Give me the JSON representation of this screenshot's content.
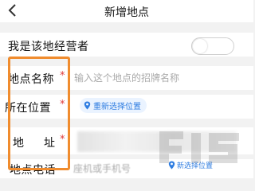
{
  "nav": {
    "title": "新增地点"
  },
  "owner_row": {
    "label": "我是该地经营者",
    "toggle_on": false
  },
  "name_row": {
    "label": "地点名称",
    "required_mark": "*",
    "placeholder": "输入这个地点的招牌名称"
  },
  "position_row": {
    "label": "所在位置",
    "required_mark": "*",
    "button_label": "重新选择位置"
  },
  "address_row": {
    "label_first": "地",
    "label_second": "址",
    "required_mark": "*"
  },
  "phone_row": {
    "label": "地点电话",
    "placeholder": "座机或手机号",
    "tag_label": "新选择位置"
  },
  "colors": {
    "accent": "#2f7de1",
    "required": "#e03a3a",
    "highlight": "#f08c2e"
  }
}
